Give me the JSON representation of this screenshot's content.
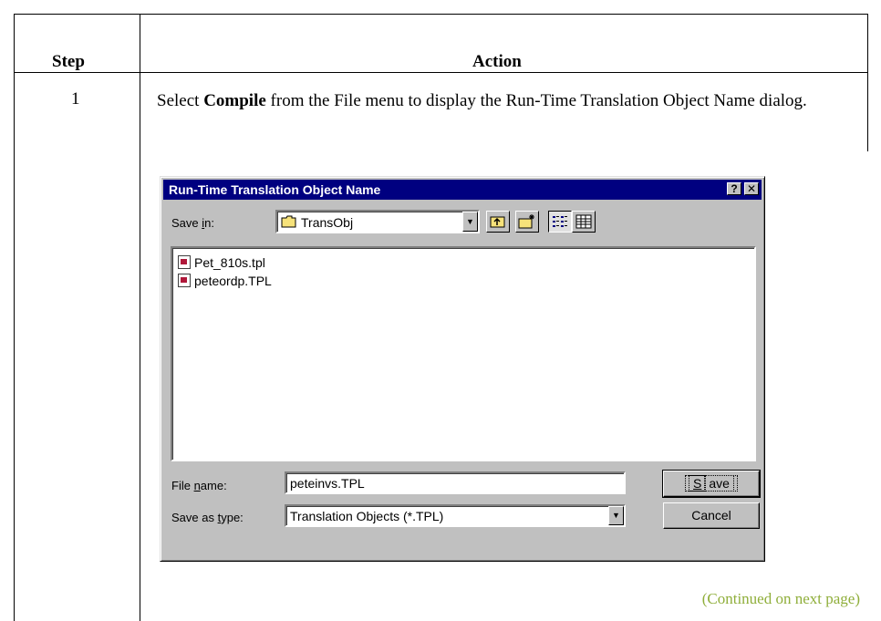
{
  "table": {
    "step_header": "Step",
    "action_header": "Action",
    "step_number": "1",
    "instruction": {
      "prefix": "Select ",
      "bold": "Compile",
      "suffix": " from the File menu to display the Run-Time Translation Object Name dialog."
    },
    "continued": "(Continued on next page)"
  },
  "dialog": {
    "title": "Run-Time Translation Object Name",
    "help_button": "?",
    "close_button": "✕",
    "save_in_label_pre": "Save ",
    "save_in_label_u": "i",
    "save_in_label_post": "n:",
    "save_in_value": "TransObj",
    "files": [
      "Pet_810s.tpl",
      "peteordp.TPL"
    ],
    "file_name_label_pre": "File ",
    "file_name_label_u": "n",
    "file_name_label_post": "ame:",
    "file_name_value": "peteinvs.TPL",
    "save_type_label_pre": "Save as ",
    "save_type_label_u": "t",
    "save_type_label_post": "ype:",
    "save_type_value": "Translation Objects (*.TPL)",
    "save_button_u": "S",
    "save_button_rest": "ave",
    "cancel_button": "Cancel"
  },
  "colors": {
    "titlebar": "#000080",
    "dialog_face": "#c0c0c0",
    "continued_text": "#8fae3a"
  }
}
